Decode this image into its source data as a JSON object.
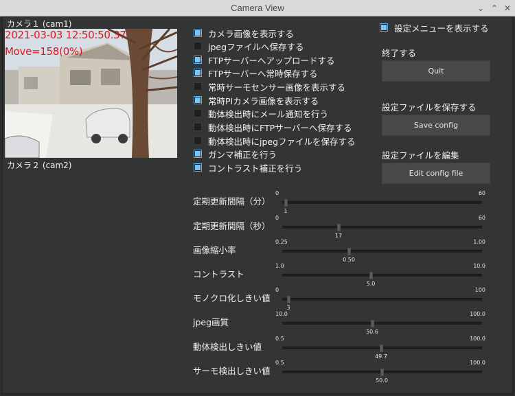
{
  "window": {
    "title": "Camera View"
  },
  "cameras": [
    {
      "label": "カメラ１ (cam1)",
      "timestamp": "2021-03-03  12:50:50.37",
      "motion": "Move=158(0%)"
    },
    {
      "label": "カメラ２ (cam2)"
    }
  ],
  "options": [
    {
      "label": "カメラ画像を表示する",
      "checked": true
    },
    {
      "label": "jpegファイルへ保存する",
      "checked": false
    },
    {
      "label": "FTPサーバーへアップロードする",
      "checked": true
    },
    {
      "label": "FTPサーバーへ常時保存する",
      "checked": true
    },
    {
      "label": "常時サーモセンサー画像を表示する",
      "checked": false
    },
    {
      "label": "常時PIカメラ画像を表示する",
      "checked": true
    },
    {
      "label": "動体検出時にメール通知を行う",
      "checked": false
    },
    {
      "label": "動体検出時にFTPサーバーへ保存する",
      "checked": false
    },
    {
      "label": "動体検出時にjpegファイルを保存する",
      "checked": false
    },
    {
      "label": "ガンマ補正を行う",
      "checked": true
    },
    {
      "label": "コントラスト補正を行う",
      "checked": true
    }
  ],
  "settings_menu": {
    "label": "設定メニューを表示する",
    "checked": true
  },
  "quit": {
    "heading": "終了する",
    "button": "Quit"
  },
  "save_config": {
    "heading": "設定ファイルを保存する",
    "button": "Save config"
  },
  "edit_config": {
    "heading": "設定ファイルを編集",
    "button": "Edit config file"
  },
  "sliders": [
    {
      "label": "定期更新間隔（分）",
      "min": "0",
      "max": "60",
      "value": "1",
      "fraction": 0.017
    },
    {
      "label": "定期更新間隔（秒）",
      "min": "0",
      "max": "60",
      "value": "17",
      "fraction": 0.283
    },
    {
      "label": "画像縮小率",
      "min": "0.25",
      "max": "1.00",
      "value": "0.50",
      "fraction": 0.333
    },
    {
      "label": "コントラスト",
      "min": "1.0",
      "max": "10.0",
      "value": "5.0",
      "fraction": 0.444
    },
    {
      "label": "モノクロ化しきい値",
      "min": "0",
      "max": "100",
      "value": "3",
      "fraction": 0.03
    },
    {
      "label": "jpeg画質",
      "min": "10.0",
      "max": "100.0",
      "value": "50.6",
      "fraction": 0.451
    },
    {
      "label": "動体検出しきい値",
      "min": "0.5",
      "max": "100.0",
      "value": "49.7",
      "fraction": 0.494
    },
    {
      "label": "サーモ検出しきい値",
      "min": "0.5",
      "max": "100.0",
      "value": "50.0",
      "fraction": 0.497
    }
  ]
}
